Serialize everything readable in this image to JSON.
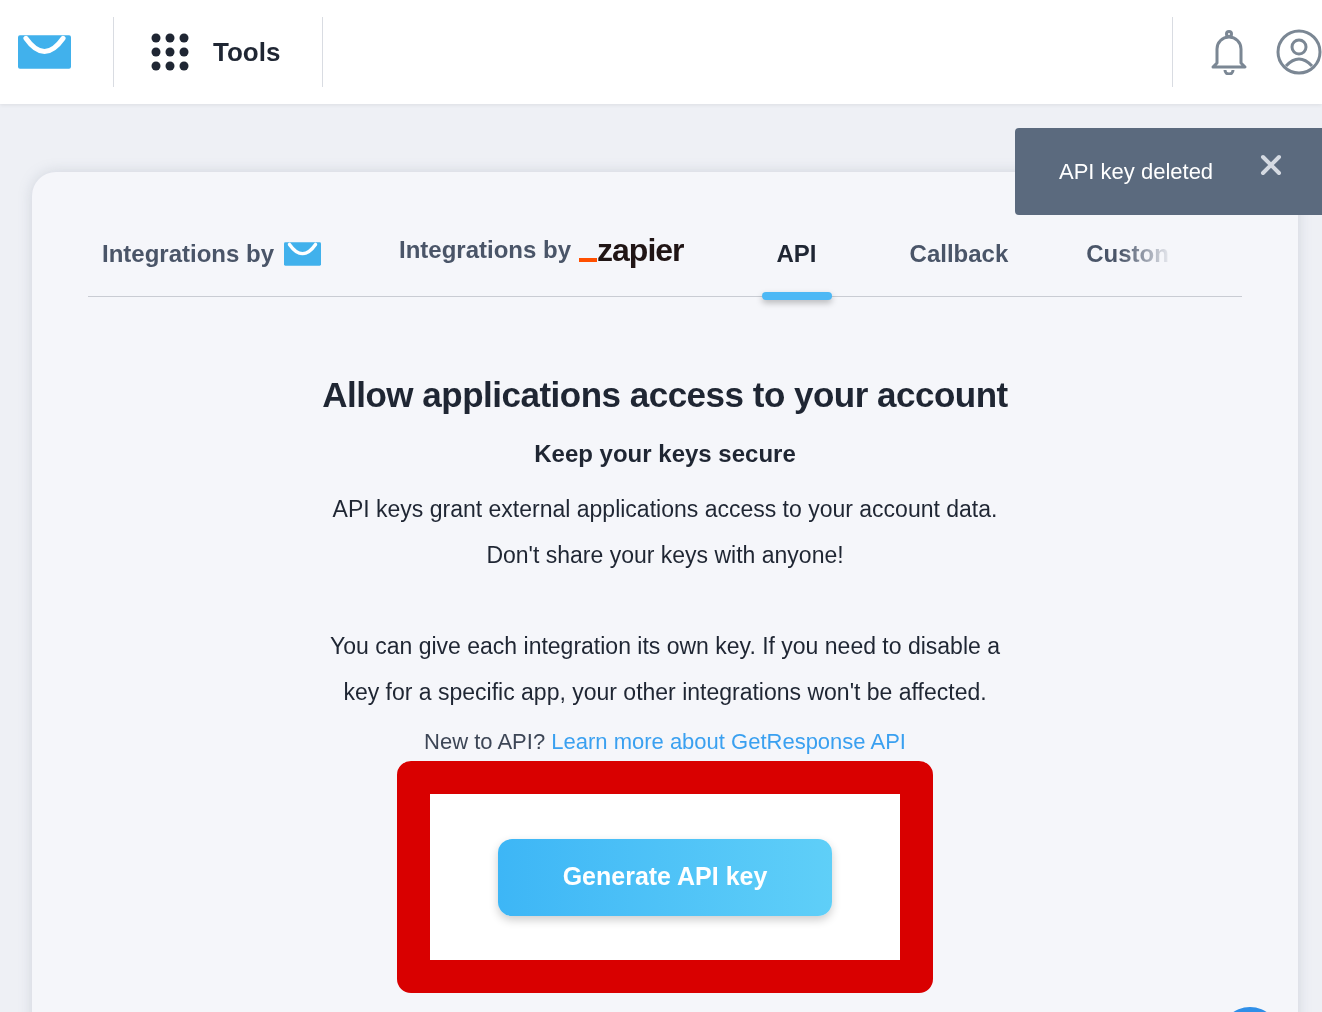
{
  "header": {
    "section_title": "Tools"
  },
  "toast": {
    "message": "API key deleted"
  },
  "tabs": [
    {
      "kind": "envelope",
      "label": "Integrations by",
      "selected": false
    },
    {
      "kind": "zapier",
      "label": "Integrations by",
      "logo_text": "zapier",
      "selected": false
    },
    {
      "kind": "text",
      "label": "API",
      "selected": true
    },
    {
      "kind": "text",
      "label": "Callback",
      "selected": false
    },
    {
      "kind": "faded",
      "label": "Custon",
      "selected": false
    }
  ],
  "content": {
    "heading": "Allow applications access to your account",
    "subheading": "Keep your keys secure",
    "paragraphs": [
      [
        "API keys grant external applications access to your account data.",
        "Don't share your keys with anyone!"
      ],
      [
        "You can give each integration its own key. If you need to disable a",
        "key for a specific app, your other integrations won't be affected."
      ]
    ],
    "link_prefix": "New to API?",
    "link": "Learn more about GetResponse API",
    "button": "Generate API key"
  }
}
